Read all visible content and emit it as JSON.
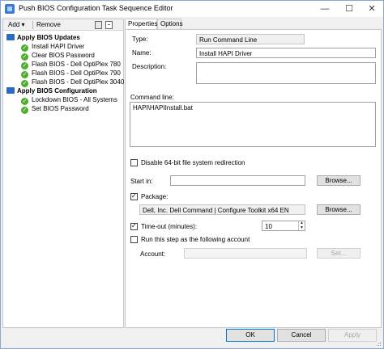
{
  "window": {
    "title": "Push BIOS Configuration Task Sequence Editor",
    "controls": {
      "minimize": "—",
      "maximize": "☐",
      "close": "✕"
    }
  },
  "toolbar": {
    "add_label": "Add ▾",
    "remove_label": "Remove"
  },
  "tree": {
    "groups": [
      {
        "label": "Apply BIOS Updates",
        "icon": "folder-icon",
        "items": [
          {
            "label": "Install HAPI Driver",
            "icon": "check-icon",
            "selected": true
          },
          {
            "label": "Clear BIOS Password",
            "icon": "check-icon"
          },
          {
            "label": "Flash BIOS - Dell OptiPlex 780",
            "icon": "check-icon"
          },
          {
            "label": "Flash BIOS - Dell OptiPlex 790",
            "icon": "check-icon"
          },
          {
            "label": "Flash BIOS - Dell OptiPlex 3040",
            "icon": "check-icon"
          }
        ]
      },
      {
        "label": "Apply BIOS Configuration",
        "icon": "folder-icon",
        "items": [
          {
            "label": "Lockdown BIOS - All Systems",
            "icon": "check-icon"
          },
          {
            "label": "Set BIOS Password",
            "icon": "check-icon"
          }
        ]
      }
    ]
  },
  "tabs": [
    {
      "label": "Properties",
      "active": true
    },
    {
      "label": "Options",
      "active": false
    }
  ],
  "properties": {
    "type_label": "Type:",
    "type_value": "Run Command Line",
    "name_label": "Name:",
    "name_value": "Install HAPI Driver",
    "description_label": "Description:",
    "description_value": "",
    "command_line_label": "Command line:",
    "command_line_value": "HAPI\\HAPIInstall.bat",
    "disable64_label": "Disable 64-bit file system redirection",
    "disable64_checked": false,
    "start_in_label": "Start in:",
    "start_in_value": "",
    "browse_label": "Browse...",
    "package_label": "Package:",
    "package_checked": true,
    "package_value": "Dell, Inc. Dell Command | Configure Toolkit x64 EN",
    "timeout_label": "Time-out (minutes):",
    "timeout_checked": true,
    "timeout_value": "10",
    "run_as_label": "Run this step as the following account",
    "run_as_checked": false,
    "account_label": "Account:",
    "account_value": "",
    "set_label": "Set..."
  },
  "footer": {
    "ok_label": "OK",
    "cancel_label": "Cancel",
    "apply_label": "Apply"
  },
  "colors": {
    "folder": "#2b6bc4",
    "check": "#4caf2a",
    "window_border": "#8aa8cf"
  }
}
